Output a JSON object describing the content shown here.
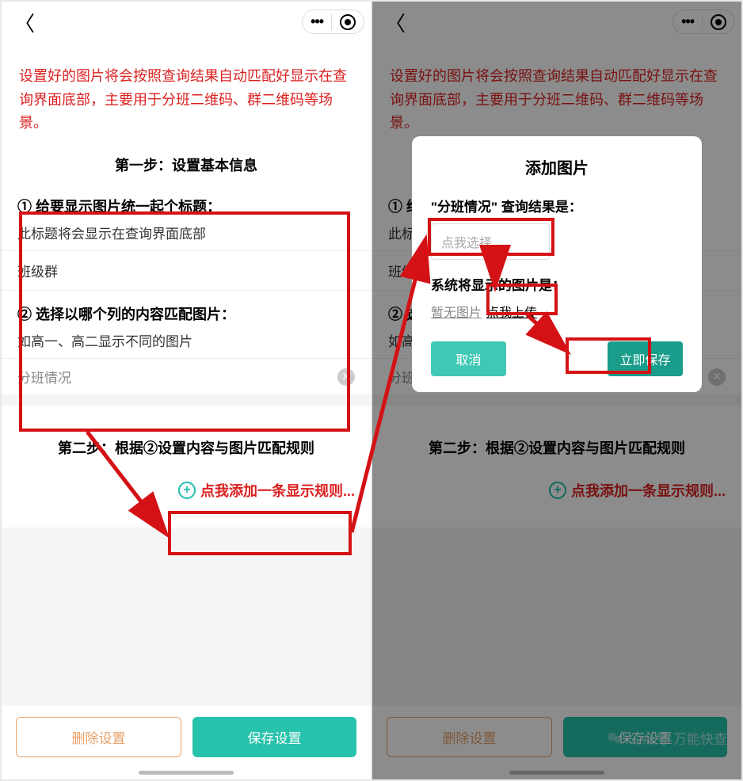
{
  "notice": "设置好的图片将会按照查询结果自动匹配好显示在查询界面底部，主要用于分班二维码、群二维码等场景。",
  "step1_title": "第一步：设置基本信息",
  "q1_label": "① 给要显示图片统一起个标题：",
  "q1_desc": "此标题将会显示在查询界面底部",
  "q1_value": "班级群",
  "q2_label": "② 选择以哪个列的内容匹配图片：",
  "q2_desc": "如高一、高二显示不同的图片",
  "q2_value": "分班情况",
  "step2_title": "第二步：根据②设置内容与图片匹配规则",
  "add_rule_label": "点我添加一条显示规则...",
  "btn_delete": "删除设置",
  "btn_save": "保存设置",
  "modal": {
    "title": "添加图片",
    "search_label": "\"分班情况\" 查询结果是：",
    "select_placeholder": "点我选择",
    "img_label": "系统将显示的图片是：",
    "no_img": "暂无图片",
    "upload": "点我上传",
    "cancel": "取消",
    "save": "立即保存"
  },
  "watermark": "公众号·万能快查"
}
